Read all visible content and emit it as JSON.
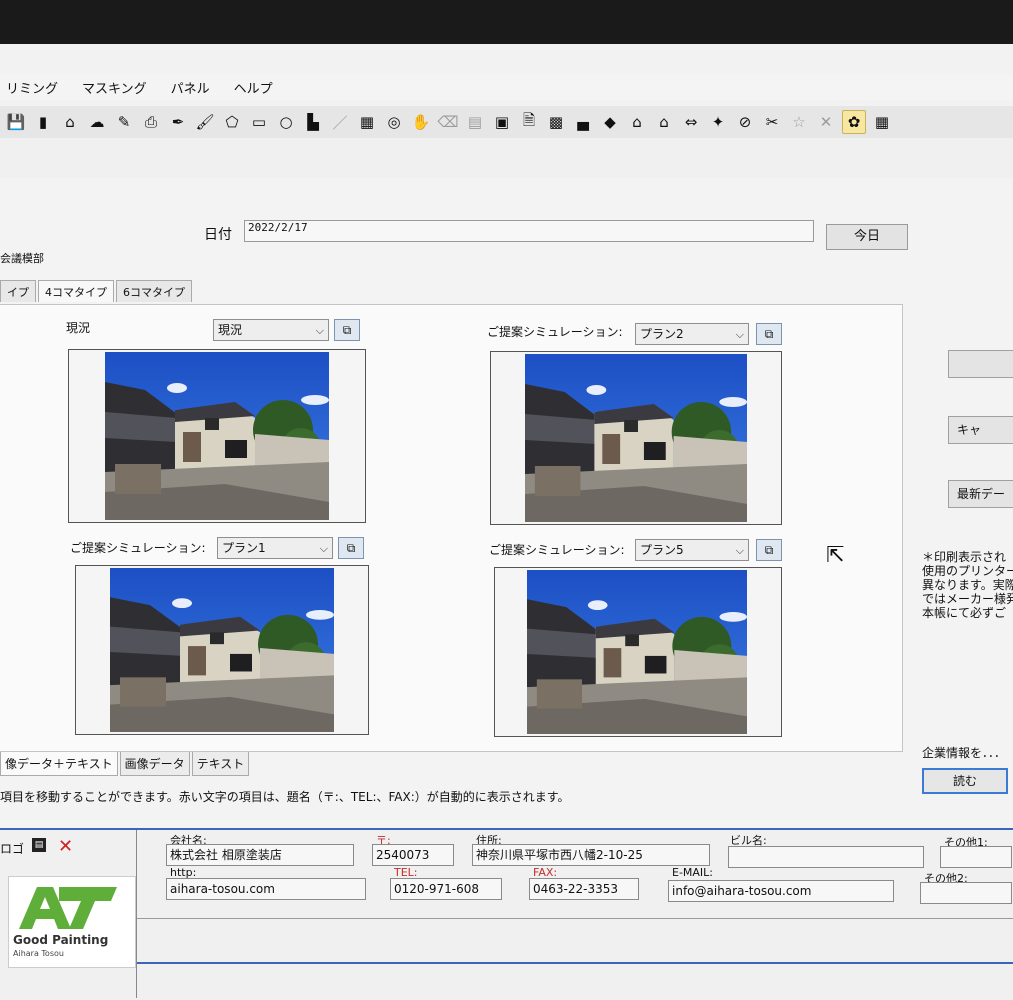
{
  "menu": [
    "リミング",
    "マスキング",
    "パネル",
    "ヘルプ"
  ],
  "toolbar_icons": [
    {
      "name": "save-icon",
      "glyph": "💾",
      "dim": false
    },
    {
      "name": "device-icon",
      "glyph": "▮",
      "dim": false
    },
    {
      "name": "home-icon",
      "glyph": "⌂",
      "dim": false
    },
    {
      "name": "cloud-upload-icon",
      "glyph": "☁",
      "dim": false
    },
    {
      "name": "edit-icon",
      "glyph": "✎",
      "dim": false
    },
    {
      "name": "print-icon",
      "glyph": "⎙",
      "dim": false
    },
    {
      "name": "pen-icon",
      "glyph": "✒",
      "dim": false
    },
    {
      "name": "brush-icon",
      "glyph": "🖌",
      "dim": false
    },
    {
      "name": "polygon-icon",
      "glyph": "⬠",
      "dim": false
    },
    {
      "name": "rectangle-icon",
      "glyph": "▭",
      "dim": false
    },
    {
      "name": "ellipse-icon",
      "glyph": "○",
      "dim": false
    },
    {
      "name": "layer-icon",
      "glyph": "▙",
      "dim": false
    },
    {
      "name": "line-icon",
      "glyph": "／",
      "dim": true
    },
    {
      "name": "table-icon",
      "glyph": "▦",
      "dim": false
    },
    {
      "name": "target-icon",
      "glyph": "◎",
      "dim": false
    },
    {
      "name": "hand-icon",
      "glyph": "✋",
      "dim": false
    },
    {
      "name": "eraser-icon",
      "glyph": "⌫",
      "dim": true
    },
    {
      "name": "fill-icon",
      "glyph": "▤",
      "dim": true
    },
    {
      "name": "image-icon",
      "glyph": "▣",
      "dim": false
    },
    {
      "name": "document-icon",
      "glyph": "🗎",
      "dim": false
    },
    {
      "name": "photo-icon",
      "glyph": "▩",
      "dim": false
    },
    {
      "name": "stamp-icon",
      "glyph": "▄",
      "dim": false
    },
    {
      "name": "pin-icon",
      "glyph": "◆",
      "dim": false
    },
    {
      "name": "house-icon",
      "glyph": "⌂",
      "dim": false
    },
    {
      "name": "house-red-icon",
      "glyph": "⌂",
      "dim": false
    },
    {
      "name": "arrows-icon",
      "glyph": "⇔",
      "dim": false
    },
    {
      "name": "pushpin-icon",
      "glyph": "✦",
      "dim": false
    },
    {
      "name": "clip-icon",
      "glyph": "⊘",
      "dim": false
    },
    {
      "name": "scissors-icon",
      "glyph": "✂",
      "dim": false
    },
    {
      "name": "star-icon",
      "glyph": "☆",
      "dim": true
    },
    {
      "name": "close-icon",
      "glyph": "✕",
      "dim": true
    },
    {
      "name": "palette-icon",
      "glyph": "✿",
      "dim": false
    },
    {
      "name": "grid-icon",
      "glyph": "▦",
      "dim": false
    }
  ],
  "date": {
    "label": "日付",
    "value": "2022/2/17",
    "today": "今日"
  },
  "company_stub": "会議模部",
  "tabs": [
    "イプ",
    "4コマタイプ",
    "6コマタイプ"
  ],
  "panels": [
    {
      "label": "現況",
      "select": "現況"
    },
    {
      "label": "ご提案シミュレーション:",
      "select": "プラン2"
    },
    {
      "label": "ご提案シミュレーション:",
      "select": "プラン1"
    },
    {
      "label": "ご提案シミュレーション:",
      "select": "プラン5"
    }
  ],
  "right_buttons": [
    "",
    "キャ",
    "最新デー"
  ],
  "notice_lines": [
    "＊印刷表示され",
    "使用のプリンター",
    "異なります。実際",
    "ではメーカー様発",
    "本帳にて必ずご"
  ],
  "corp_info_label": "企業情報を．．．",
  "read_button": "読む",
  "bottom_tabs": [
    "像データ＋テキスト",
    "画像データ",
    "テキスト"
  ],
  "hint": "項目を移動することができます。赤い文字の項目は、題名（〒:、TEL:、FAX:）が自動的に表示されます。",
  "footer": {
    "header": "ロゴ",
    "company_label": "会社名:",
    "company": "株式会社 相原塗装店",
    "zip_label": "〒:",
    "zip": "2540073",
    "address_label": "住所:",
    "address": "神奈川県平塚市西八幡2-10-25",
    "building_label": "ビル名:",
    "building": "",
    "other1_label": "その他1:",
    "other1": "",
    "http_label": "http:",
    "http": "aihara-tosou.com",
    "tel_label": "TEL:",
    "tel": "0120-971-608",
    "fax_label": "FAX:",
    "fax": "0463-22-3353",
    "email_label": "E-MAIL:",
    "email": "info@aihara-tosou.com",
    "other2_label": "その他2:",
    "other2": ""
  },
  "logo": {
    "mark": "AT",
    "line1": "Good Painting",
    "line2": "Aihara Tosou",
    "color": "#5fae3a"
  }
}
